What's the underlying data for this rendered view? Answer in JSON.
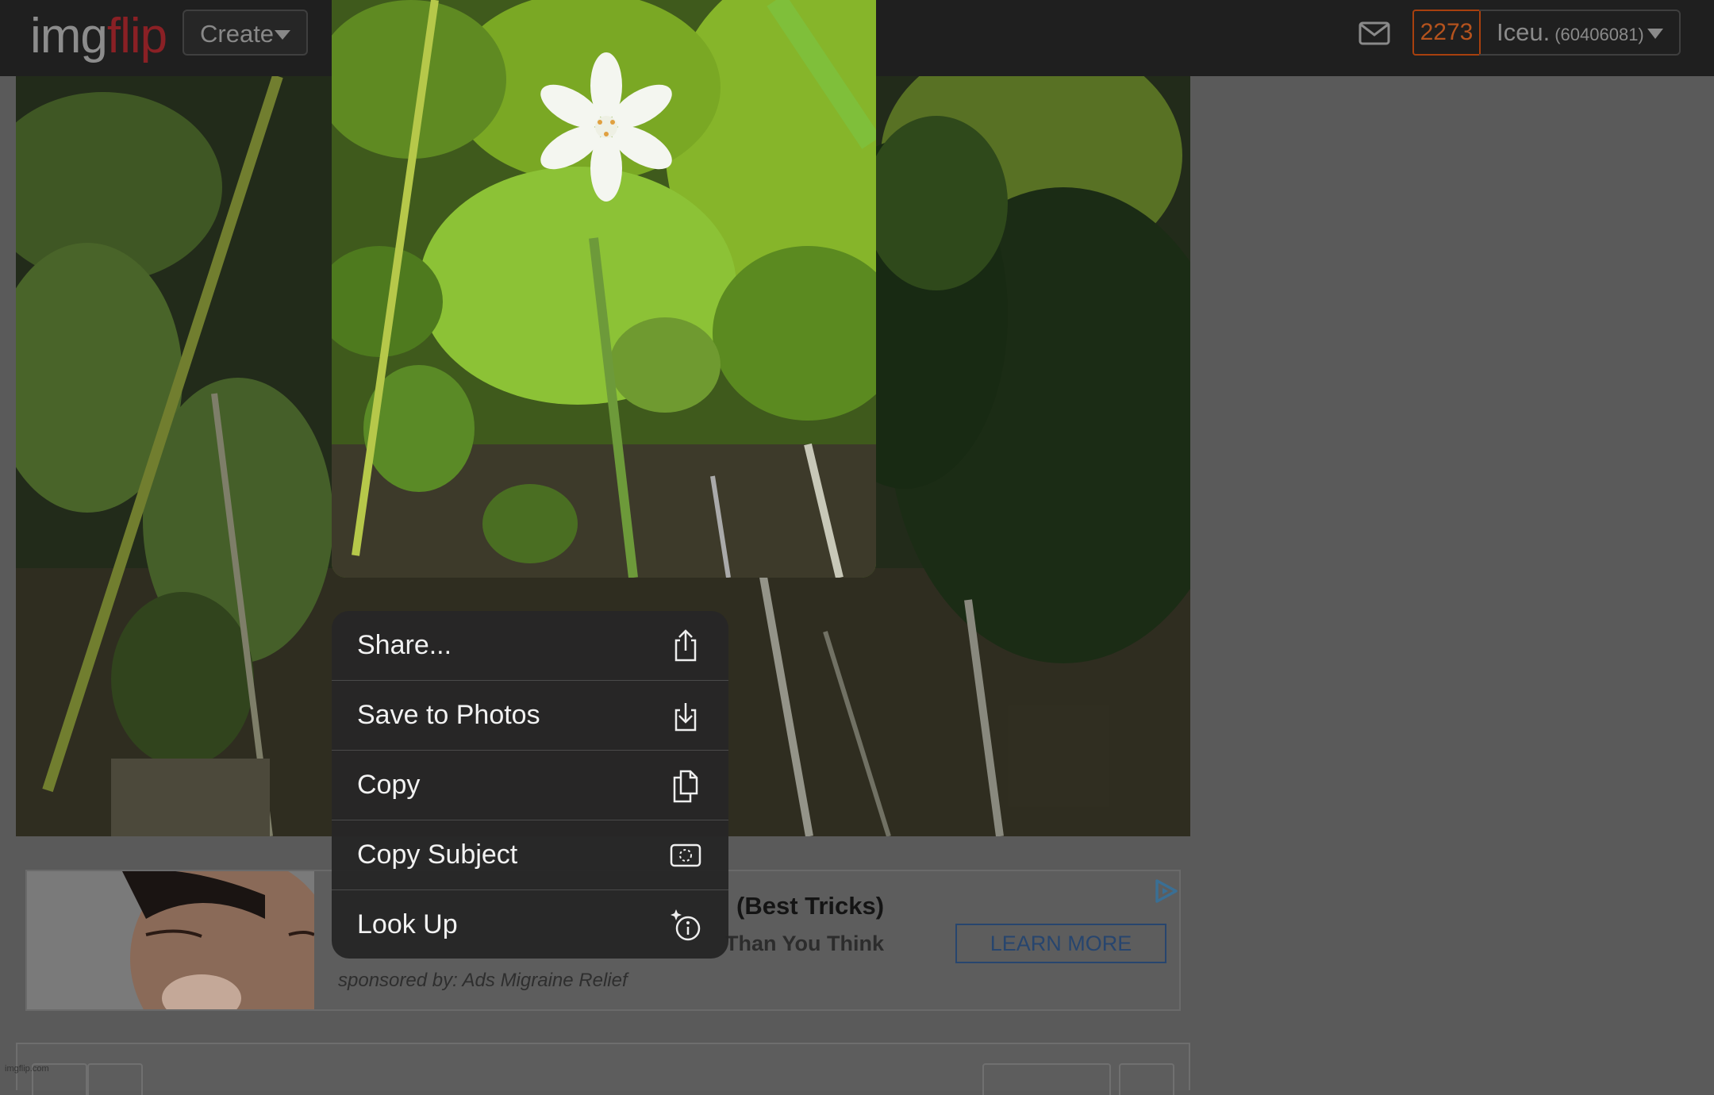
{
  "header": {
    "logo_part1": "img",
    "logo_part2": "flip",
    "create_label": "Create",
    "points": "2273",
    "username": "Iceu.",
    "user_id": "(60406081)",
    "icons": {
      "mail": "mail-icon",
      "create_caret": "chevron-down-icon",
      "user_caret": "chevron-down-icon"
    },
    "colors": {
      "bar": "#1f1f1f",
      "logo_flip": "#8a2025",
      "points": "#b5531d"
    }
  },
  "context_menu": {
    "items": [
      {
        "label": "Share...",
        "icon": "share-icon"
      },
      {
        "label": "Save to Photos",
        "icon": "save-to-photos-icon"
      },
      {
        "label": "Copy",
        "icon": "copy-icon"
      },
      {
        "label": "Copy Subject",
        "icon": "copy-subject-icon"
      },
      {
        "label": "Look Up",
        "icon": "look-up-icon"
      }
    ]
  },
  "ad": {
    "title": "(Best Tricks)",
    "subtitle": "Than You Think",
    "sponsor": "sponsored by: Ads Migraine Relief",
    "cta": "LEARN MORE",
    "icon": "ad-choices-icon"
  },
  "footer": {
    "credit": "imgflip.com"
  }
}
